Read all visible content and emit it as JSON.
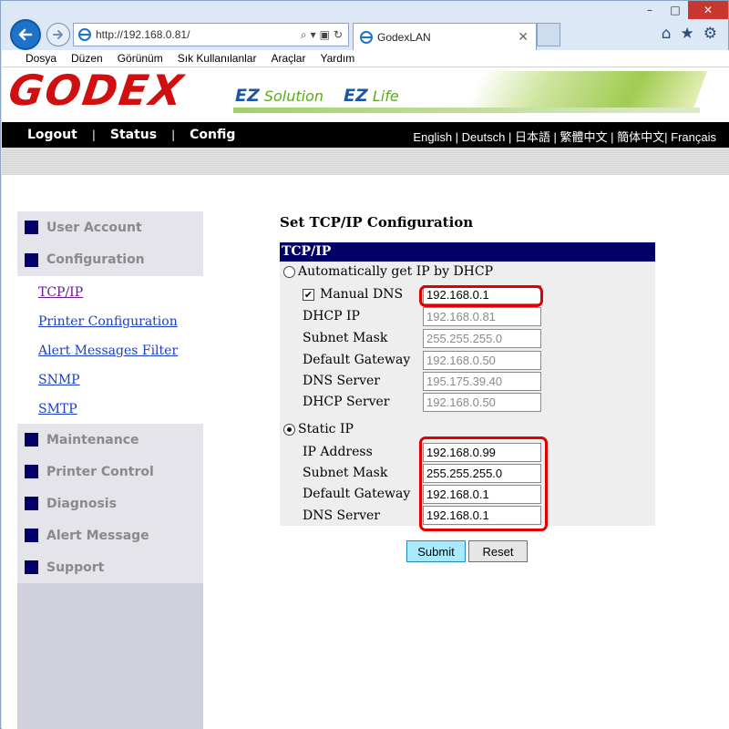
{
  "browser": {
    "url": "http://192.168.0.81/",
    "tab_title": "GodexLAN",
    "window_controls": [
      "–",
      "□",
      "✕"
    ],
    "menu": [
      "Dosya",
      "Düzen",
      "Görünüm",
      "Sık Kullanılanlar",
      "Araçlar",
      "Yardım"
    ]
  },
  "banner": {
    "logo": "GODEX",
    "ez1_prefix": "EZ",
    "ez1_word": "Solution",
    "ez2_prefix": "EZ",
    "ez2_word": "Life"
  },
  "topnav": {
    "logout": "Logout",
    "status": "Status",
    "config": "Config",
    "separator": "|",
    "languages": "English | Deutsch | 日本語 | 繁體中文 | 簡体中文| Français"
  },
  "sidebar": {
    "user_account": "User Account",
    "configuration": "Configuration",
    "links": [
      "TCP/IP",
      "Printer Configuration",
      "Alert Messages Filter",
      "SNMP",
      "SMTP"
    ],
    "maintenance": "Maintenance",
    "printer_control": "Printer Control",
    "diagnosis": "Diagnosis",
    "alert_message": "Alert Message",
    "support": "Support"
  },
  "form": {
    "title": "Set TCP/IP Configuration",
    "section": "TCP/IP",
    "dhcp_label": "Automatically get IP by DHCP",
    "manual_dns_label": "Manual DNS",
    "manual_dns_value": "192.168.0.1",
    "dhcp_ip_label": "DHCP IP",
    "dhcp_ip_value": "192.168.0.81",
    "dhcp_mask_label": "Subnet Mask",
    "dhcp_mask_value": "255.255.255.0",
    "dhcp_gw_label": "Default Gateway",
    "dhcp_gw_value": "192.168.0.50",
    "dhcp_dns_label": "DNS Server",
    "dhcp_dns_value": "195.175.39.40",
    "dhcp_server_label": "DHCP Server",
    "dhcp_server_value": "192.168.0.50",
    "static_label": "Static IP",
    "ip_label": "IP Address",
    "ip_value": "192.168.0.99",
    "mask_label": "Subnet Mask",
    "mask_value": "255.255.255.0",
    "gw_label": "Default Gateway",
    "gw_value": "192.168.0.1",
    "dns_label": "DNS Server",
    "dns_value": "192.168.0.1",
    "submit": "Submit",
    "reset": "Reset"
  },
  "colors": {
    "nav_bg": "#000000",
    "section_header": "#000066",
    "logo_red": "#d01010",
    "highlight_red": "#e00000",
    "link_blue": "#1a3fc4"
  }
}
